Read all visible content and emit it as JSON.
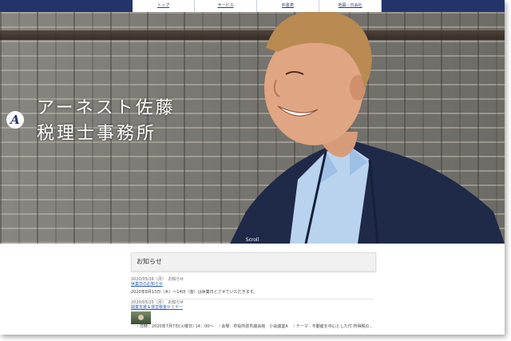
{
  "nav": {
    "items": [
      "トップ",
      "サービス",
      "料金表",
      "地図・日会社"
    ]
  },
  "hero": {
    "logo_letter": "A",
    "title_line1": "アーネスト佐藤",
    "title_line2": "税理士事務所",
    "scroll_label": "Scroll"
  },
  "news": {
    "heading": "お知らせ",
    "items": [
      {
        "date": "2020/05/26（月）　お知らせ",
        "title": "休業日のお知らせ",
        "body": "2020年8月13日（木）～14日（金）は休業日とさせていただきます。"
      },
      {
        "date": "2020/05/25（月）　お知らせ",
        "title": "開業支援＆運営税金セミナー",
        "body": "・日時：2020年7月7日(火曜日) 14：00～　・会場：市役所前市議会館　小会議室A　・テーマ：不動産を中心とした付 所得税の..."
      }
    ]
  },
  "colors": {
    "nav_bar": "#22346a",
    "nav_text": "#2a3f7a",
    "link": "#2a5db0"
  }
}
